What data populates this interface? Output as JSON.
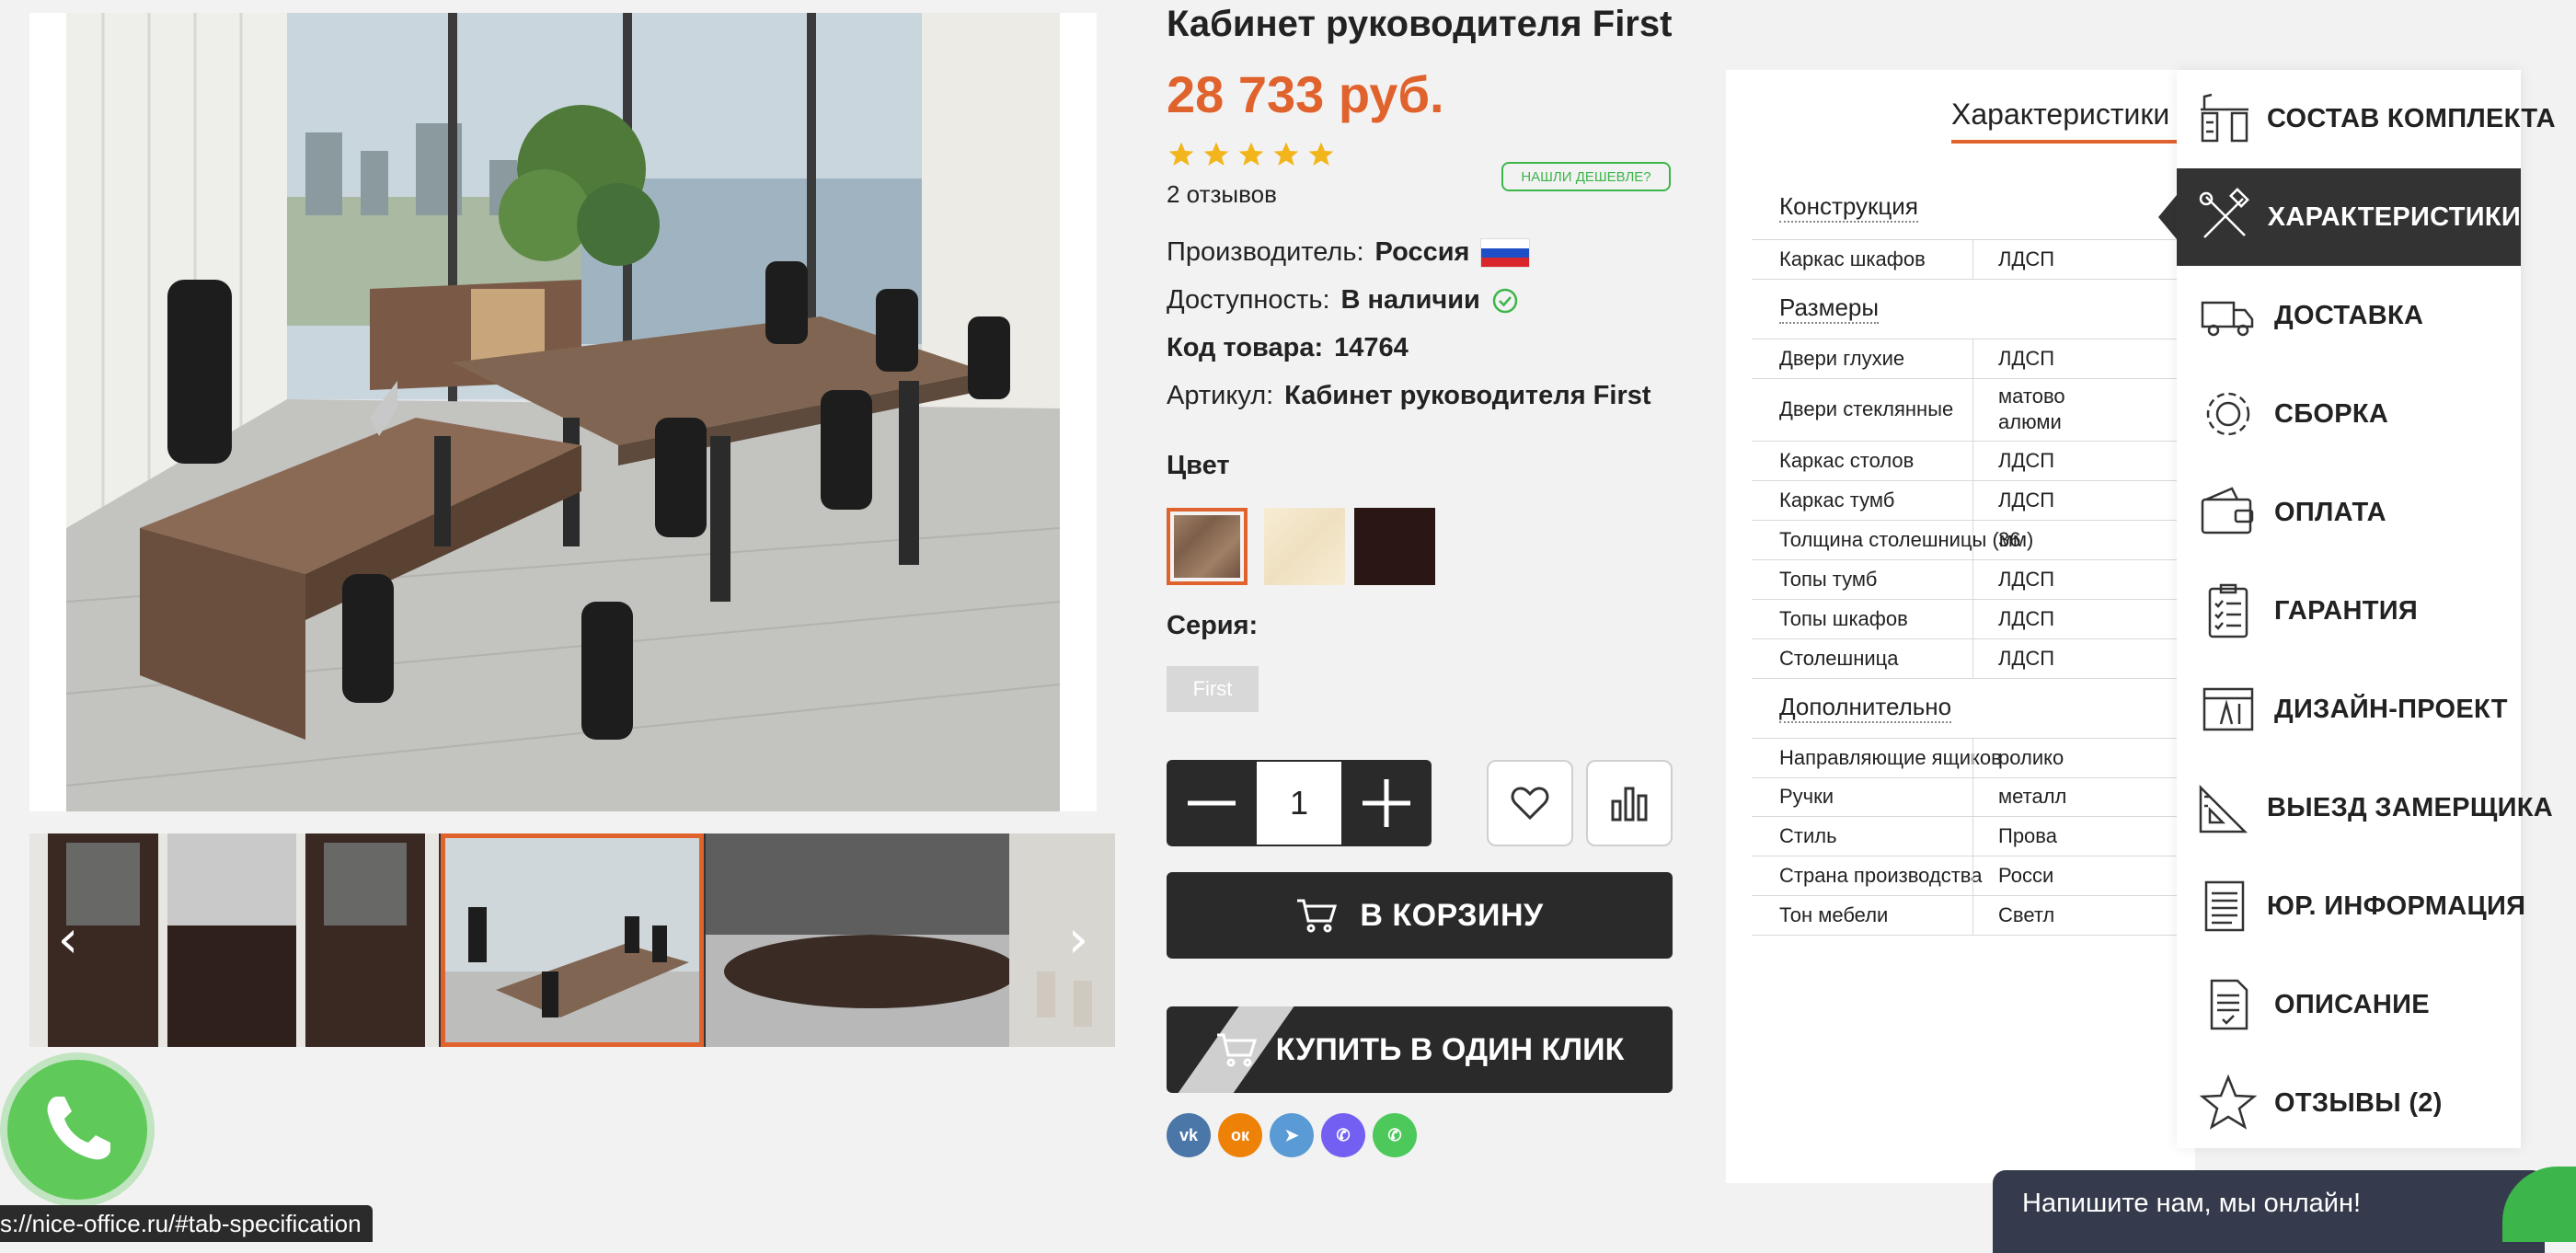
{
  "product": {
    "title": "Кабинет руководителя First",
    "price": "28 733 руб.",
    "rating": 5,
    "reviews": "2 отзывов",
    "cheaper_button": "НАШЛИ ДЕШЕВЛЕ?",
    "manufacturer_label": "Производитель:",
    "manufacturer_value": "Россия",
    "availability_label": "Доступность:",
    "availability_value": "В наличии",
    "code_label": "Код товара:",
    "code_value": "14764",
    "article_label": "Артикул:",
    "article_value": "Кабинет руководителя First",
    "color_label": "Цвет",
    "colors": [
      "#8d6b52",
      "#f4e7c8",
      "#2a1714"
    ],
    "series_label": "Серия:",
    "series_tag": "First",
    "quantity": "1",
    "cart_button": "В КОРЗИНУ",
    "oneclick_button": "КУПИТЬ В ОДИН КЛИК"
  },
  "share": [
    {
      "name": "vk",
      "label": "vk",
      "color": "#4a76a8"
    },
    {
      "name": "ok",
      "label": "ок",
      "color": "#ee8208"
    },
    {
      "name": "telegram",
      "label": "➤",
      "color": "#5a9bd5"
    },
    {
      "name": "viber",
      "label": "✆",
      "color": "#7360f2"
    },
    {
      "name": "whatsapp",
      "label": "✆",
      "color": "#4cc95a"
    }
  ],
  "spec": {
    "tab_title": "Характеристики",
    "groups": {
      "construction": "Конструкция",
      "sizes": "Размеры",
      "extra": "Дополнительно"
    },
    "rows": [
      {
        "k": "Каркас шкафов",
        "v": "ЛДСП"
      },
      {
        "k": "Двери глухие",
        "v": "ЛДСП"
      },
      {
        "k": "Двери стеклянные",
        "v": "матово",
        "v2": "алюми"
      },
      {
        "k": "Каркас столов",
        "v": "ЛДСП"
      },
      {
        "k": "Каркас тумб",
        "v": "ЛДСП"
      },
      {
        "k": "Толщина столешницы (мм)",
        "v": "36"
      },
      {
        "k": "Топы тумб",
        "v": "ЛДСП"
      },
      {
        "k": "Топы шкафов",
        "v": "ЛДСП"
      },
      {
        "k": "Столешница",
        "v": "ЛДСП"
      },
      {
        "k": "Направляющие ящиков",
        "v": "ролико"
      },
      {
        "k": "Ручки",
        "v": "металл"
      },
      {
        "k": "Стиль",
        "v": "Прова"
      },
      {
        "k": "Страна производства",
        "v": "Росси"
      },
      {
        "k": "Тон мебели",
        "v": "Светл"
      }
    ]
  },
  "nav": [
    {
      "label": "СОСТАВ КОМПЛЕКТА",
      "icon": "furniture-icon"
    },
    {
      "label": "ХАРАКТЕРИСТИКИ",
      "icon": "tools-icon",
      "active": true
    },
    {
      "label": "ДОСТАВКА",
      "icon": "truck-icon"
    },
    {
      "label": "СБОРКА",
      "icon": "gear-icon"
    },
    {
      "label": "ОПЛАТА",
      "icon": "wallet-icon"
    },
    {
      "label": "ГАРАНТИЯ",
      "icon": "checklist-icon"
    },
    {
      "label": "ДИЗАЙН-ПРОЕКТ",
      "icon": "blueprint-icon"
    },
    {
      "label": "ВЫЕЗД ЗАМЕРЩИКА",
      "icon": "ruler-icon"
    },
    {
      "label": "ЮР. ИНФОРМАЦИЯ",
      "icon": "document-icon"
    },
    {
      "label": "ОПИСАНИЕ",
      "icon": "description-icon"
    },
    {
      "label": "ОТЗЫВЫ (2)",
      "icon": "star-icon"
    }
  ],
  "chat": "Напишите нам, мы онлайн!",
  "status_url": "s://nice-office.ru/#tab-specification",
  "colors": {
    "accent": "#e0622c",
    "dark": "#2a2a2a",
    "green": "#3cb54a",
    "chat": "#353b4c"
  }
}
